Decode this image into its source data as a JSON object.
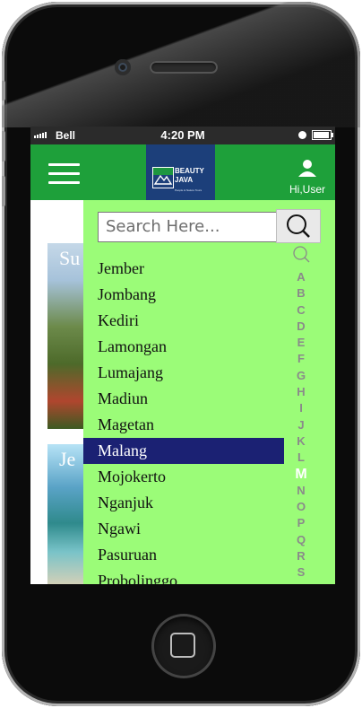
{
  "status_bar": {
    "carrier": "Bell",
    "time": "4:20 PM"
  },
  "app_bar": {
    "logo_title": "BEAUTY OF JAVA",
    "logo_title_lines": [
      "BEAUTY",
      "JAVA"
    ],
    "logo_tagline": "People & Nature Tours",
    "user_label": "Hi,User"
  },
  "background_cards": [
    {
      "title": "Su"
    },
    {
      "title": "Je"
    }
  ],
  "search": {
    "placeholder": "Search Here..."
  },
  "cities": [
    "Jember",
    "Jombang",
    "Kediri",
    "Lamongan",
    "Lumajang",
    "Madiun",
    "Magetan",
    "Malang",
    "Mojokerto",
    "Nganjuk",
    "Ngawi",
    "Pasuruan",
    "Probolinggo"
  ],
  "selected_city": "Malang",
  "alphabet": [
    "A",
    "B",
    "C",
    "D",
    "E",
    "F",
    "G",
    "H",
    "I",
    "J",
    "K",
    "L",
    "M",
    "N",
    "O",
    "P",
    "Q",
    "R",
    "S"
  ],
  "selected_letter": "M",
  "colors": {
    "app_bar": "#1ea03a",
    "panel": "#9bfc78",
    "selected_row": "#1b2173",
    "logo_bg": "#1c3f7a"
  }
}
